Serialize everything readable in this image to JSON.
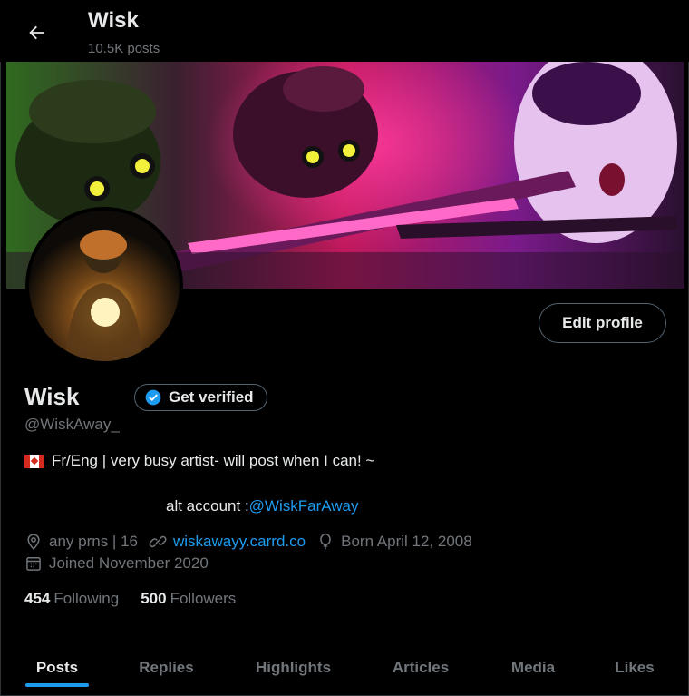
{
  "header": {
    "title": "Wisk",
    "post_count": "10.5K posts"
  },
  "profile": {
    "name": "Wisk",
    "handle": "@WiskAway_",
    "get_verified_label": "Get verified",
    "edit_profile_label": "Edit profile",
    "bio_line1": "Fr/Eng | very busy artist- will post when I can! ~",
    "bio_line2_prefix": "alt account :",
    "bio_line2_link": "@WiskFarAway",
    "pronouns": "any prns | 16",
    "website": "wiskawayy.carrd.co",
    "birthday": "Born April 12, 2008",
    "joined": "Joined November 2020",
    "following_count": "454",
    "following_label": "Following",
    "followers_count": "500",
    "followers_label": "Followers"
  },
  "tabs": [
    {
      "label": "Posts",
      "active": true
    },
    {
      "label": "Replies",
      "active": false
    },
    {
      "label": "Highlights",
      "active": false
    },
    {
      "label": "Articles",
      "active": false
    },
    {
      "label": "Media",
      "active": false
    },
    {
      "label": "Likes",
      "active": false
    }
  ],
  "colors": {
    "accent": "#1d9bf0",
    "muted": "#71767b",
    "text": "#e7e9ea",
    "background": "#000000"
  },
  "icons": [
    "back-arrow-icon",
    "verified-badge-icon",
    "location-icon",
    "link-icon",
    "balloon-icon",
    "calendar-icon"
  ]
}
